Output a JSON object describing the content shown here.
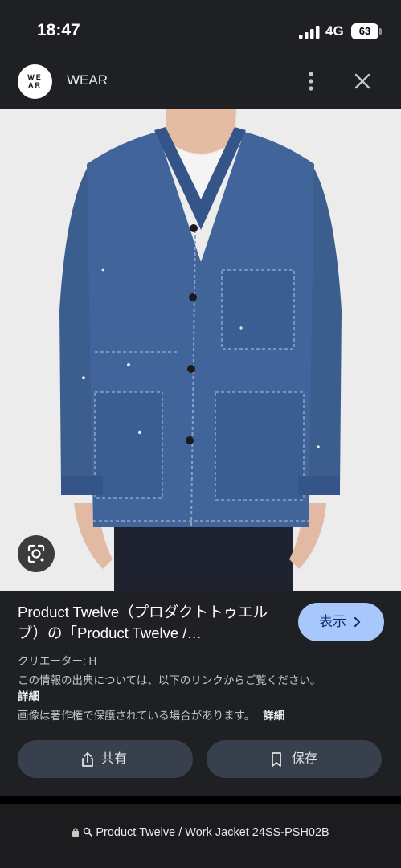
{
  "status": {
    "time": "18:47",
    "network": "4G",
    "battery": "63"
  },
  "header": {
    "logo_text": "WE\nAR",
    "site_name": "WEAR"
  },
  "image": {
    "description_icon": "lens-icon"
  },
  "info": {
    "title": "Product Twelve（プロダクトトゥエルブ）の「Product Twelve /…",
    "view_label": "表示",
    "creator": "クリエーター: H",
    "source_text": "この情報の出典については、以下のリンクからご覧ください。",
    "source_link": "詳細",
    "copyright_text": "画像は著作権で保護されている場合があります。",
    "copyright_link": "詳細",
    "share_label": "共有",
    "save_label": "保存"
  },
  "url_bar": {
    "url": "Product Twelve / Work Jacket 24SS-PSH02B"
  },
  "colors": {
    "panel": "#1f2023",
    "accent_button": "#a8c7fa",
    "secondary_button": "#38404d"
  }
}
